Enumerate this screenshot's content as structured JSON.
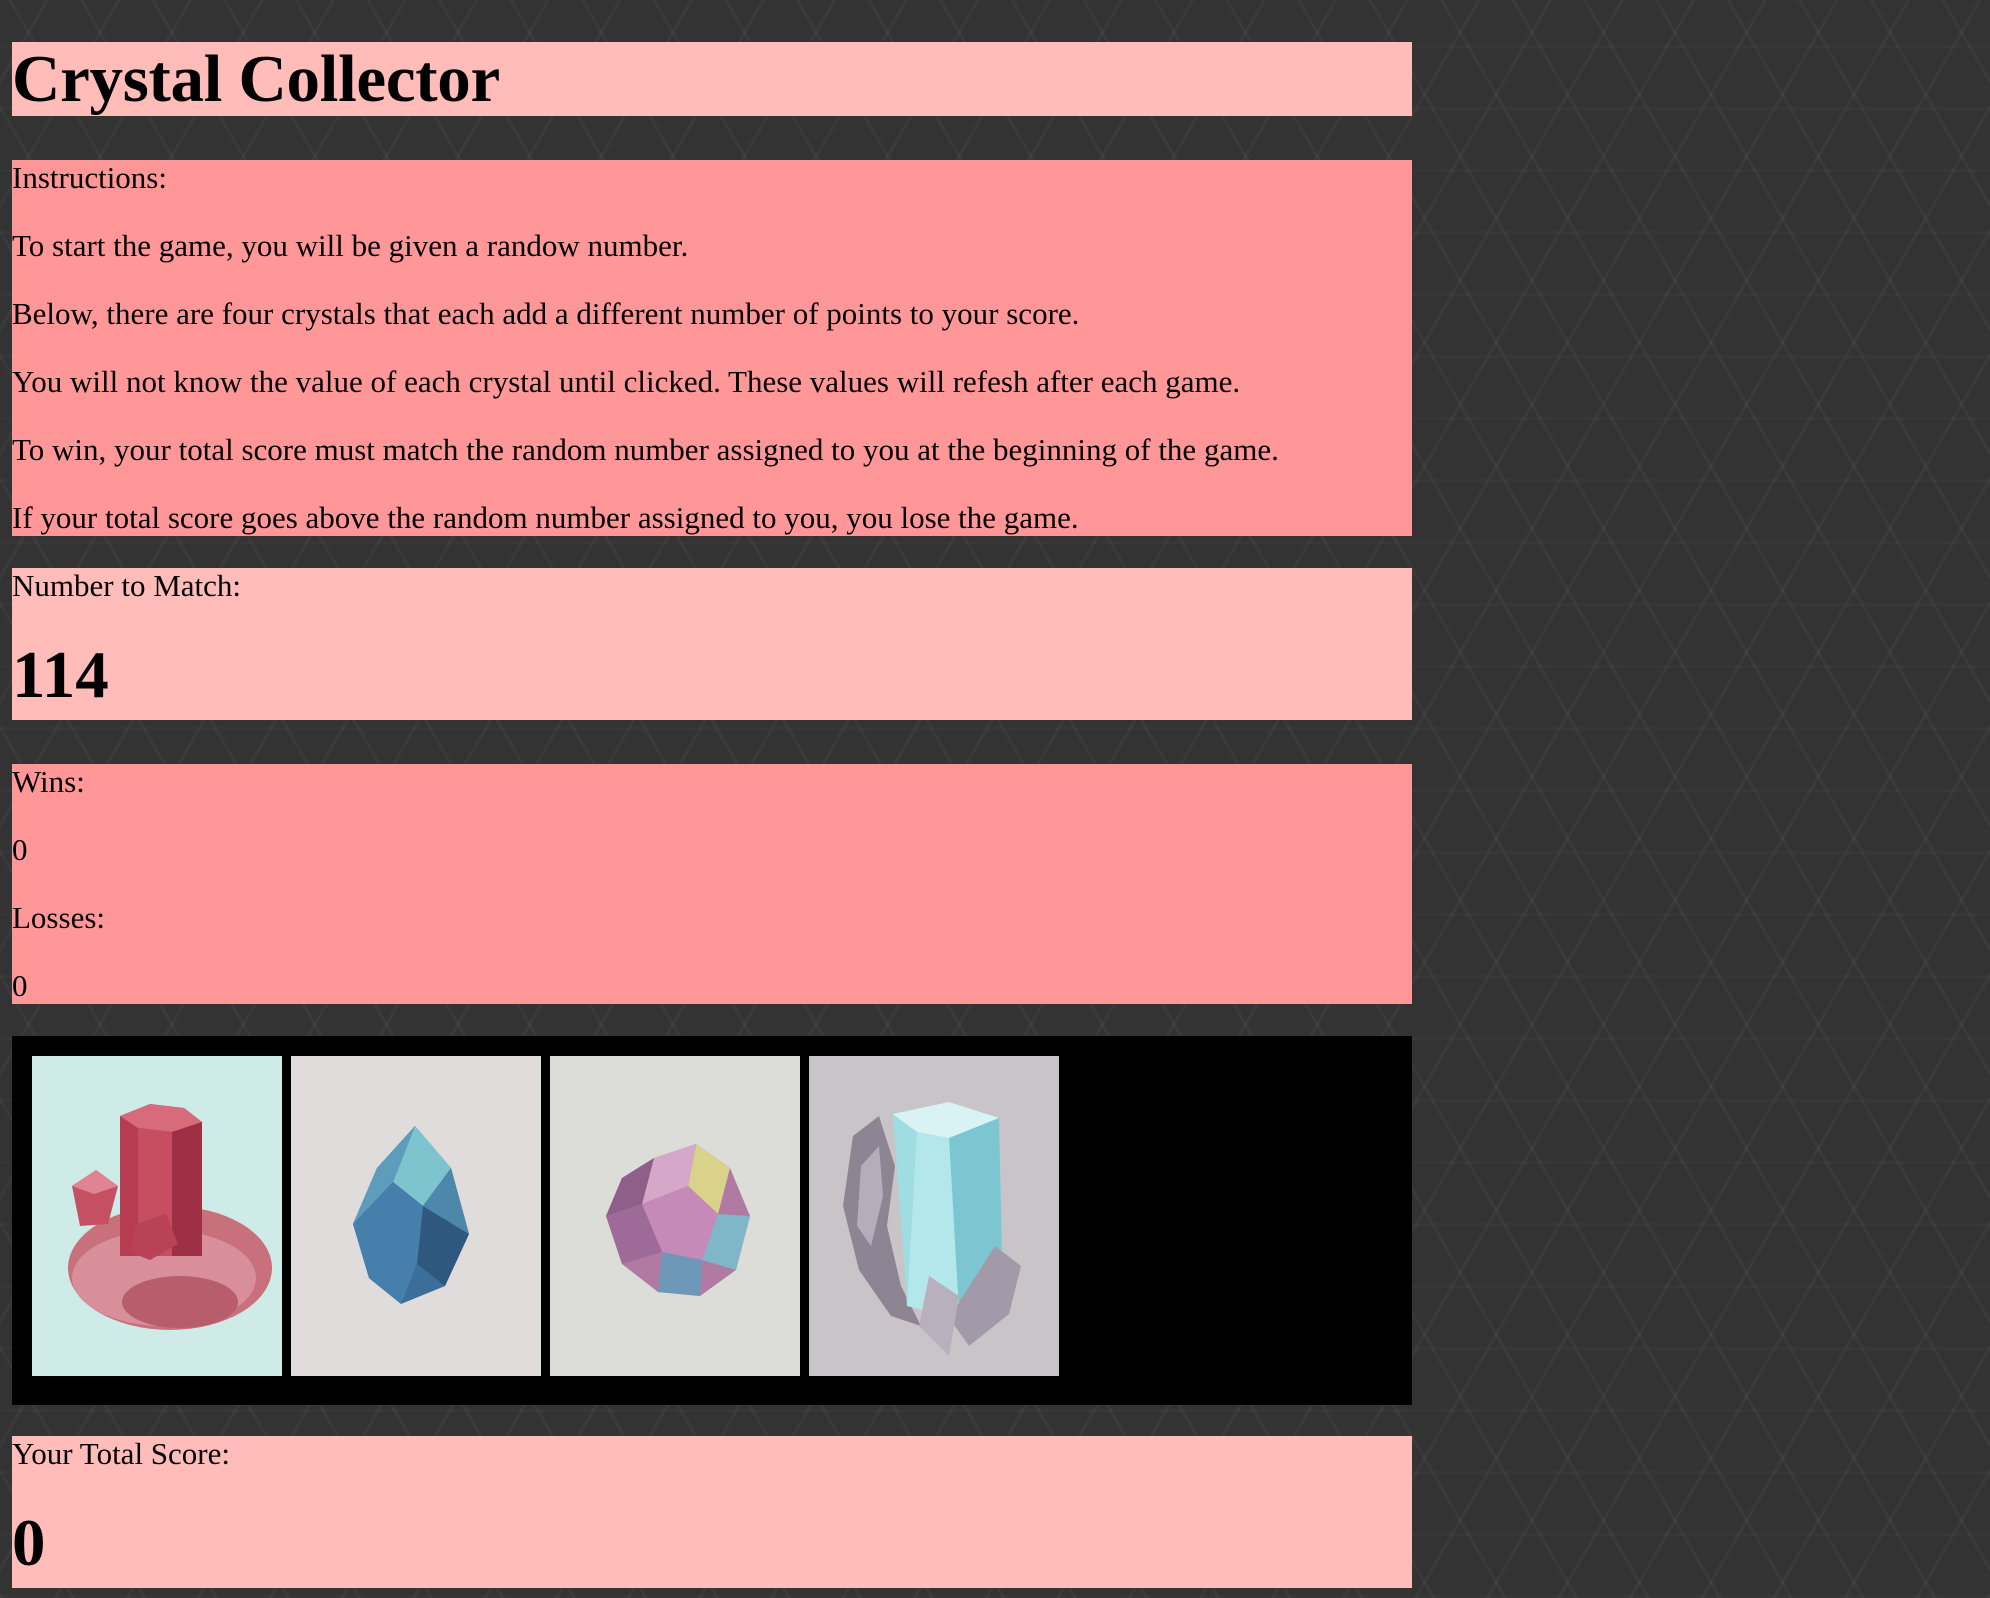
{
  "title": "Crystal Collector",
  "instructions": {
    "heading": "Instructions:",
    "lines": [
      "To start the game, you will be given a randow number.",
      "Below, there are four crystals that each add a different number of points to your score.",
      "You will not know the value of each crystal until clicked. These values will refesh after each game.",
      "To win, your total score must match the random number assigned to you at the beginning of the game.",
      "If your total score goes above the random number assigned to you, you lose the game."
    ]
  },
  "target": {
    "label": "Number to Match:",
    "value": "114"
  },
  "stats": {
    "wins_label": "Wins:",
    "wins_value": "0",
    "losses_label": "Losses:",
    "losses_value": "0"
  },
  "crystals": [
    {
      "name": "red-crystal-icon",
      "background": "#cfebe8"
    },
    {
      "name": "blue-crystal-icon",
      "background": "#e1dcdc"
    },
    {
      "name": "purple-crystal-icon",
      "background": "#dcdcd9"
    },
    {
      "name": "aqua-crystal-icon",
      "background": "#c9c4c7"
    }
  ],
  "score": {
    "label": "Your Total Score:",
    "value": "0"
  },
  "colors": {
    "background": "#333333",
    "panel_light": "#ffbcb9",
    "panel_dark": "#ff9698",
    "crystal_panel": "#000000"
  }
}
